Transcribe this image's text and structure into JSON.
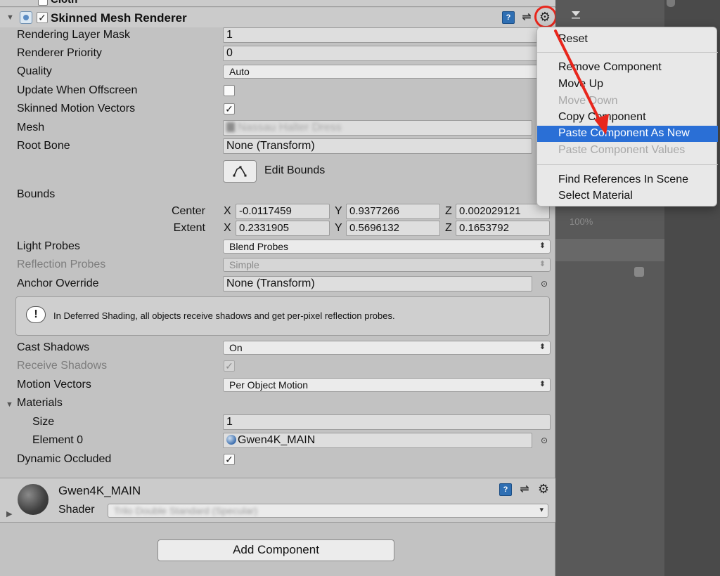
{
  "cloth_header": {
    "title": "Cloth"
  },
  "component": {
    "title": "Skinned Mesh Renderer",
    "enabled": true
  },
  "fields": {
    "rendering_layer_mask": {
      "label": "Rendering Layer Mask",
      "value": "1"
    },
    "renderer_priority": {
      "label": "Renderer Priority",
      "value": "0"
    },
    "quality": {
      "label": "Quality",
      "value": "Auto"
    },
    "update_when_offscreen": {
      "label": "Update When Offscreen",
      "checked": false
    },
    "skinned_motion_vectors": {
      "label": "Skinned Motion Vectors",
      "checked": true
    },
    "mesh": {
      "label": "Mesh",
      "value": "Nassau Halter Dress"
    },
    "root_bone": {
      "label": "Root Bone",
      "value": "None (Transform)"
    },
    "edit_bounds": {
      "label": "Edit Bounds"
    },
    "bounds": {
      "label": "Bounds",
      "center_label": "Center",
      "extent_label": "Extent",
      "x": "X",
      "y": "Y",
      "z": "Z",
      "center": {
        "x": "-0.0117459",
        "y": "0.9377266",
        "z": "0.002029121"
      },
      "extent": {
        "x": "0.2331905",
        "y": "0.5696132",
        "z": "0.1653792"
      }
    },
    "light_probes": {
      "label": "Light Probes",
      "value": "Blend Probes"
    },
    "reflection_probes": {
      "label": "Reflection Probes",
      "value": "Simple"
    },
    "anchor_override": {
      "label": "Anchor Override",
      "value": "None (Transform)"
    },
    "help_text": "In Deferred Shading, all objects receive shadows and get per-pixel reflection probes.",
    "cast_shadows": {
      "label": "Cast Shadows",
      "value": "On"
    },
    "receive_shadows": {
      "label": "Receive Shadows",
      "checked": true
    },
    "motion_vectors": {
      "label": "Motion Vectors",
      "value": "Per Object Motion"
    },
    "materials": {
      "label": "Materials",
      "size_label": "Size",
      "size_value": "1",
      "element0_label": "Element 0",
      "element0_value": "Gwen4K_MAIN"
    },
    "dynamic_occluded": {
      "label": "Dynamic Occluded",
      "checked": true
    }
  },
  "material_header": {
    "name": "Gwen4K_MAIN",
    "shader_label": "Shader",
    "shader_value": "Trilo Double Standard (Specular)"
  },
  "add_component_label": "Add Component",
  "right_panel": {
    "zoom": "100%"
  },
  "context_menu": {
    "items": [
      {
        "label": "Reset",
        "enabled": true
      },
      {
        "label": "Remove Component",
        "enabled": true
      },
      {
        "label": "Move Up",
        "enabled": true
      },
      {
        "label": "Move Down",
        "enabled": false
      },
      {
        "label": "Copy Component",
        "enabled": true
      },
      {
        "label": "Paste Component As New",
        "enabled": true,
        "highlighted": true
      },
      {
        "label": "Paste Component Values",
        "enabled": false
      },
      {
        "label": "Find References In Scene",
        "enabled": true
      },
      {
        "label": "Select Material",
        "enabled": true
      }
    ]
  },
  "colors": {
    "menu_highlight": "#2a6fd6",
    "annotation_red": "#e8261c"
  }
}
